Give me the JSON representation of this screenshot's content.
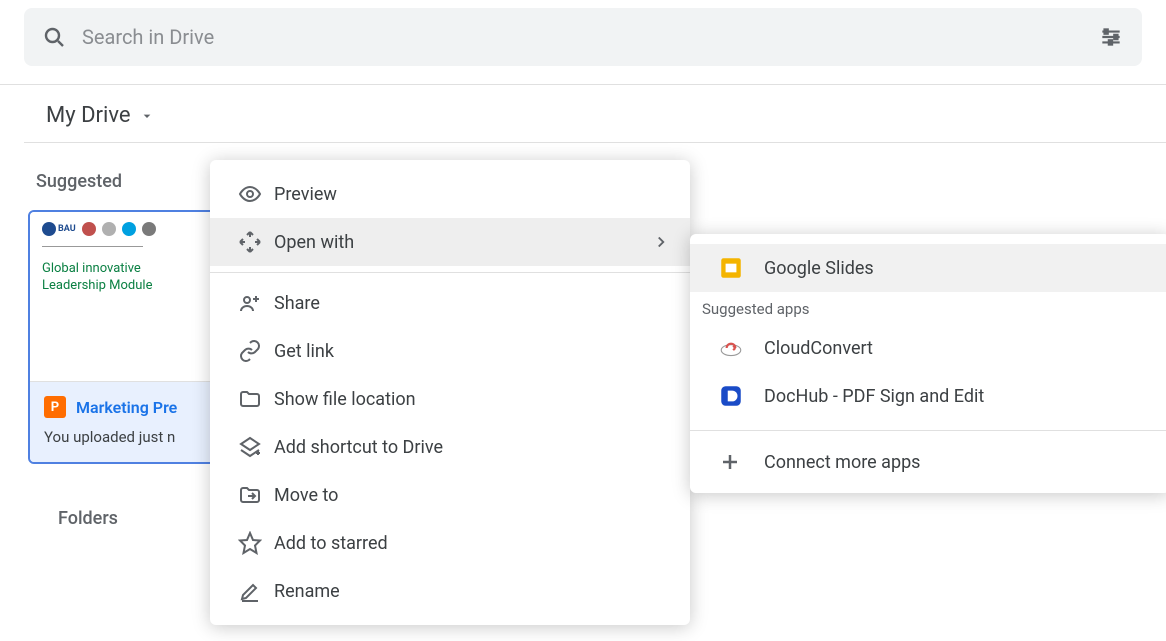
{
  "search": {
    "placeholder": "Search in Drive"
  },
  "breadcrumb": {
    "title": "My Drive"
  },
  "sections": {
    "suggested": "Suggested",
    "folders": "Folders"
  },
  "card": {
    "thumb_line1": "Global  innovative",
    "thumb_line2": "Leadership Module",
    "filename": "Marketing Pre",
    "subtext": "You uploaded just n"
  },
  "menu": {
    "preview": "Preview",
    "open_with": "Open with",
    "share": "Share",
    "get_link": "Get link",
    "show_location": "Show file location",
    "add_shortcut": "Add shortcut to Drive",
    "move_to": "Move to",
    "add_starred": "Add to starred",
    "rename": "Rename"
  },
  "submenu": {
    "google_slides": "Google Slides",
    "suggested_apps": "Suggested apps",
    "cloudconvert": "CloudConvert",
    "dochub": "DocHub - PDF Sign and Edit",
    "connect_more": "Connect more apps"
  }
}
